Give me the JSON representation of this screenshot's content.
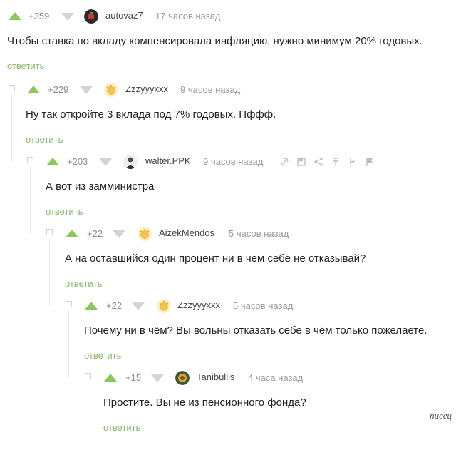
{
  "comments": [
    {
      "rating": "+359",
      "author": "autovaz7",
      "time": "17 часов назад",
      "text": "Чтобы ставка по вкладу компенсировала инфляцию, нужно минимум 20% годовых.",
      "reply": "ответить",
      "avatar": "dark-cup-avatar"
    },
    {
      "rating": "+229",
      "author": "Zzzyyyxxx",
      "time": "9 часов назад",
      "text": "Ну так откройте 3 вклада под 7% годовых. Пффф.",
      "reply": "ответить",
      "avatar": "sunshine-avatar"
    },
    {
      "rating": "+203",
      "author": "walter.PPK",
      "time": "9 часов назад",
      "text": "А вот из замминистра",
      "reply": "ответить",
      "avatar": "agent-avatar",
      "tools": [
        "link-icon",
        "save-icon",
        "share-icon",
        "up-arrow-icon",
        "branch-icon",
        "flag-icon"
      ]
    },
    {
      "rating": "+22",
      "author": "AizekMendos",
      "time": "5 часов назад",
      "text": "А на оставшийся один процент ни в чем себе не отказывай?",
      "reply": "ответить",
      "avatar": "sunshine-avatar"
    },
    {
      "rating": "+22",
      "author": "Zzzyyyxxx",
      "time": "5 часов назад",
      "text": "Почему ни в чём? Вы вольны отказать себе в чём только пожелаете.",
      "reply": "ответить",
      "avatar": "sunshine-avatar"
    },
    {
      "rating": "+15",
      "author": "Tanibullis",
      "time": "4 часа назад",
      "text": "Простите. Вы не из пенсионного фонда?",
      "reply": "ответить",
      "avatar": "colorful-avatar"
    }
  ],
  "colors": {
    "upvote": "#8ac858",
    "reply": "#8ab866",
    "downvote": "#d4d4d4",
    "muted": "#9a9a9a"
  },
  "watermark": "писец"
}
